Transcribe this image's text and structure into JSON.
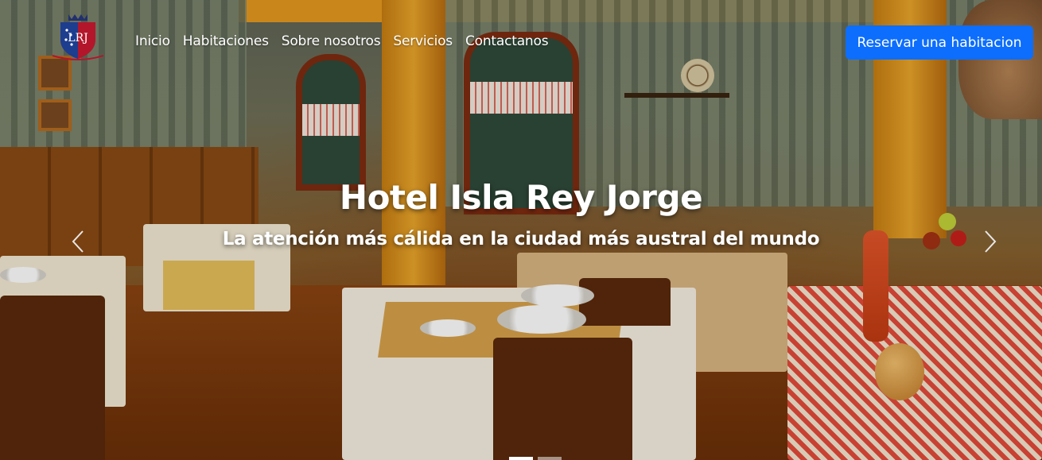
{
  "brand": {
    "logo_letters": "LRJ",
    "logo_colors": {
      "shield_blue": "#1d3d8f",
      "shield_red": "#b3162a",
      "crown": "#22306e"
    }
  },
  "nav": {
    "items": [
      {
        "label": "Inicio"
      },
      {
        "label": "Habitaciones"
      },
      {
        "label": "Sobre nosotros"
      },
      {
        "label": "Servicios"
      },
      {
        "label": "Contactanos"
      }
    ],
    "cta_label": "Reservar una habitacion",
    "cta_color": "#0d6efd"
  },
  "hero": {
    "title": "Hotel Isla Rey Jorge",
    "subtitle": "La atención más cálida en la ciudad más austral del mundo",
    "prev_icon": "chevron-left-icon",
    "next_icon": "chevron-right-icon",
    "slides_count": 2,
    "active_slide": 1
  }
}
